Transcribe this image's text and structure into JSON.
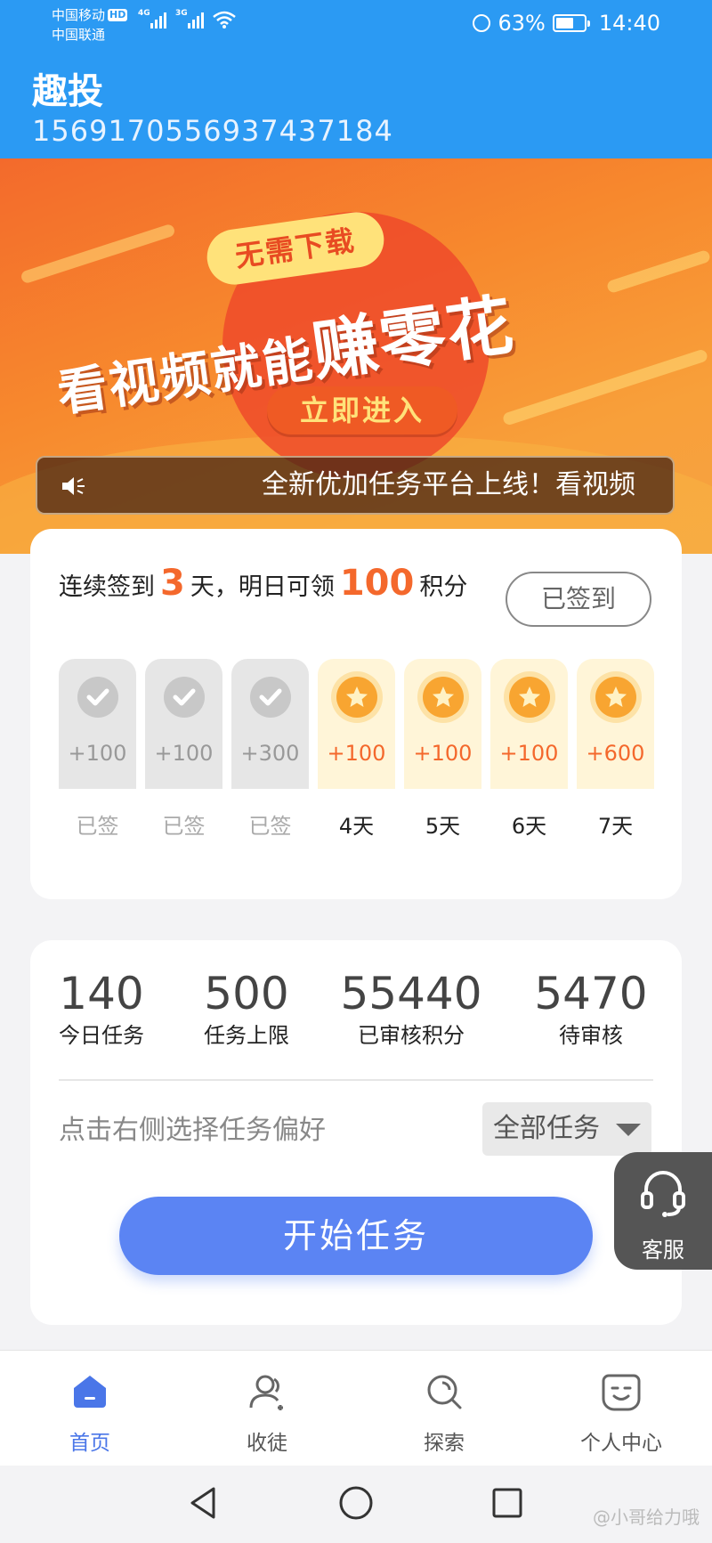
{
  "status_bar": {
    "carrier1": "中国移动",
    "hd": "HD",
    "carrier2": "中国联通",
    "net1": "4G",
    "net2": "3G",
    "battery": "63%",
    "time": "14:40"
  },
  "header": {
    "title": "趣投",
    "user_id": "1569170556937437184"
  },
  "banner": {
    "bubble": "无需下载",
    "headline_left": "看视频就能",
    "headline_big": "赚零花",
    "enter_label": "立即进入",
    "notice": "全新优加任务平台上线！看视频"
  },
  "checkin": {
    "prefix": "连续签到",
    "streak_days": "3",
    "mid": "天，明日可领",
    "tomorrow_points": "100",
    "suffix": "积分",
    "signed_label": "已签到",
    "days": [
      {
        "points": "+100",
        "label": "已签",
        "done": true
      },
      {
        "points": "+100",
        "label": "已签",
        "done": true
      },
      {
        "points": "+300",
        "label": "已签",
        "done": true
      },
      {
        "points": "+100",
        "label": "4天",
        "done": false
      },
      {
        "points": "+100",
        "label": "5天",
        "done": false
      },
      {
        "points": "+100",
        "label": "6天",
        "done": false
      },
      {
        "points": "+600",
        "label": "7天",
        "done": false
      }
    ]
  },
  "stats": {
    "items": [
      {
        "value": "140",
        "caption": "今日任务"
      },
      {
        "value": "500",
        "caption": "任务上限"
      },
      {
        "value": "55440",
        "caption": "已审核积分"
      },
      {
        "value": "5470",
        "caption": "待审核"
      }
    ],
    "pref_hint": "点击右侧选择任务偏好",
    "pref_value": "全部任务",
    "start_label": "开始任务"
  },
  "service": {
    "label": "客服",
    "icon": "headset-icon"
  },
  "tabs": [
    {
      "label": "首页",
      "icon": "home-icon",
      "active": true
    },
    {
      "label": "收徒",
      "icon": "users-icon",
      "active": false
    },
    {
      "label": "探索",
      "icon": "explore-icon",
      "active": false
    },
    {
      "label": "个人中心",
      "icon": "smile-icon",
      "active": false
    }
  ],
  "watermark": "@小哥给力哦",
  "colors": {
    "primary": "#2b9af3",
    "accent": "#f4682c",
    "button": "#5b84f3",
    "tab_active": "#4a76e8"
  }
}
